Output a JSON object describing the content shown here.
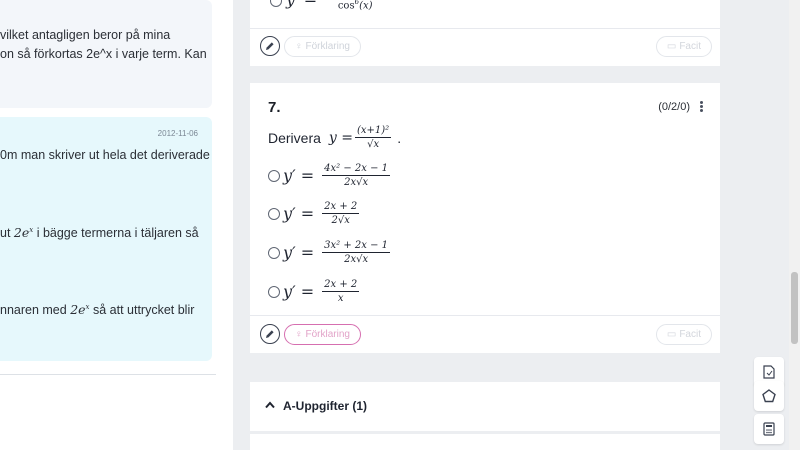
{
  "comments": {
    "first": {
      "line1": "vilket antagligen beror på mina",
      "line2": "on så förkortas 2e^x i varje term. Kan"
    },
    "second": {
      "date": "2012-11-06",
      "line1": "0m man skriver ut hela det deriverade",
      "line2_pre": "ut ",
      "line2_math": "2e",
      "line2_sup": "x",
      "line2_post": " i bägge termerna i täljaren så",
      "line3_pre": "nnaren med ",
      "line3_math": "2e",
      "line3_sup": "x",
      "line3_post": " så att uttrycket blir"
    }
  },
  "prev_card": {
    "partial_option": {
      "lhs": "y′ =",
      "den_pre": "cos",
      "den_sup": "6",
      "den_post": "(x)"
    },
    "hint_label": "Förklaring",
    "facit_label": "Facit"
  },
  "question7": {
    "number": "7.",
    "score": "(0/2/0)",
    "prompt_word": "Derivera",
    "prompt_lhs": "y =",
    "prompt_num": "(x+1)²",
    "prompt_den": "√x",
    "prompt_end": ".",
    "options": [
      {
        "lhs": "y′ =",
        "num": "4x² − 2x − 1",
        "den": "2x√x"
      },
      {
        "lhs": "y′ =",
        "num": "2x + 2",
        "den": "2√x"
      },
      {
        "lhs": "y′ =",
        "num": "3x² + 2x − 1",
        "den": "2x√x"
      },
      {
        "lhs": "y′ =",
        "num": "2x + 2",
        "den": "x"
      }
    ],
    "hint_label": "Förklaring",
    "facit_label": "Facit"
  },
  "section": {
    "title": "A-Uppgifter (1)"
  },
  "icons": {
    "pen": "pencil-icon",
    "hint": "lightbulb-icon",
    "facit": "chat-icon",
    "kebab": "more-vertical-icon",
    "chevron": "chevron-up-icon",
    "tool1": "document-icon",
    "tool2": "pentagon-icon",
    "tool3": "calculator-icon"
  },
  "colors": {
    "hint_active_border": "#d66fb0",
    "comment_highlight_bg": "#e6f8fc",
    "page_bg": "#eceef1"
  }
}
